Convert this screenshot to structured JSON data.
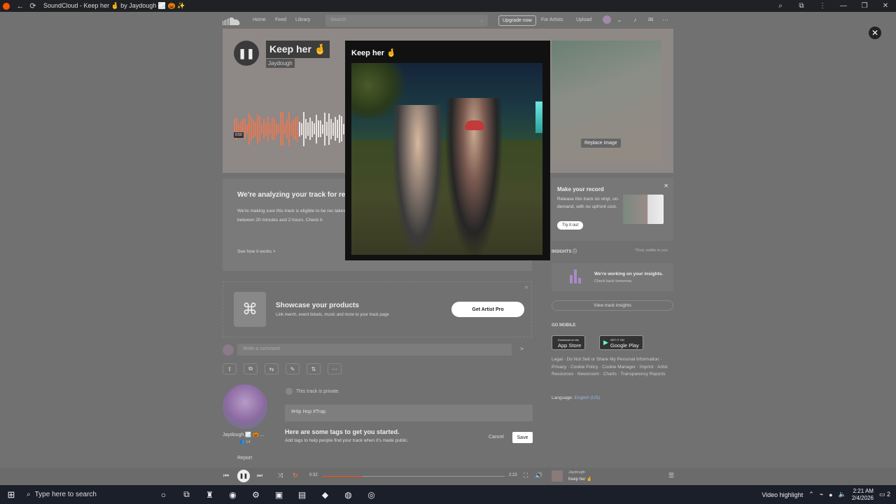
{
  "browser": {
    "tab_title": "SoundCloud - Keep her 🤞 by Jaydough 🌫️ 🎃 ✨",
    "back_icon": "arrow-left-icon",
    "reload_icon": "reload-icon"
  },
  "nav": {
    "home": "Home",
    "feed": "Feed",
    "library": "Library",
    "search_placeholder": "Search",
    "upgrade": "Upgrade now",
    "for_artists": "For Artists",
    "upload": "Upload"
  },
  "track": {
    "title": "Keep her 🤞",
    "artist": "Jaydough",
    "elapsed_short": "0:50",
    "replace_image": "Replace image"
  },
  "analyze": {
    "title": "We're analyzing your track for re",
    "body": "We're making sure this track is eligible to be rec takes between 20 minutes and 2 hours. Check b",
    "how": "See how it works >"
  },
  "showcase": {
    "title": "Showcase your products",
    "desc": "Link merch, event tickets, music and more to your track page",
    "button": "Get Artist Pro"
  },
  "comment": {
    "placeholder": "Write a comment"
  },
  "user": {
    "name": "Jaydough 🌫️ 🎃 ...",
    "followers": "14",
    "report": "Report"
  },
  "privacy": {
    "text": "This track is private."
  },
  "tags": {
    "value": "#Hip Hop  #Trap",
    "hint_title": "Here are some tags to get you started.",
    "hint_desc": "Add tags to help people find your track when it's made public.",
    "cancel": "Cancel",
    "save": "Save"
  },
  "vinyl": {
    "title": "Make your record",
    "desc": "Release this track on vinyl, on-demand, with no upfront cost.",
    "cta": "Try it out"
  },
  "insights": {
    "head": "INSIGHTS",
    "note": "*Only visible to you",
    "title": "We're working on your insights.",
    "sub": "Check back tomorrow.",
    "view": "View track insights"
  },
  "mobile": {
    "head": "GO MOBILE",
    "app_store": "App Store",
    "app_store_small": "Download on the",
    "google_play": "Google Play",
    "google_play_small": "GET IT ON"
  },
  "footer": {
    "links": "Legal · Do Not Sell or Share My Personal Information · Privacy · Cookie Policy · Cookie Manager · Imprint · Artist Resources · Newsroom · Charts · Transparency Reports",
    "language_label": "Language:",
    "language_value": "English (US)"
  },
  "player": {
    "elapsed": "0:32",
    "duration": "2:23",
    "progress_fraction": 0.22,
    "np_artist": "Jaydough",
    "np_title": "Keep her 🤞"
  },
  "modal": {
    "title": "Keep her 🤞"
  },
  "taskbar": {
    "search": "Type here to search",
    "video": "Video highlight",
    "time": "2:21 AM",
    "date": "2/4/2026",
    "notifications": "2"
  },
  "colors": {
    "accent": "#ff5500",
    "modal_bg": "#111111"
  }
}
